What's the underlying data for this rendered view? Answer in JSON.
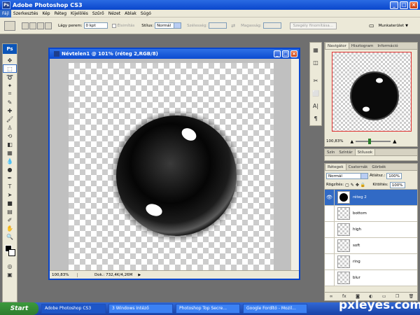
{
  "app": {
    "title": "Adobe Photoshop CS3",
    "ps_glyph": "Ps"
  },
  "menu": [
    "Fájl",
    "Szerkesztés",
    "Kép",
    "Réteg",
    "Kijelölés",
    "Szűrő",
    "Nézet",
    "Ablak",
    "Súgó"
  ],
  "options": {
    "feather_label": "Lágy perem:",
    "feather_value": "0 kpt",
    "antialias_label": "Élsimítás",
    "style_label": "Stílus:",
    "style_value": "Normál",
    "width_label": "Szélesség:",
    "height_label": "Magasság:",
    "refine_button": "Szegély finomítása...",
    "workspace_label": "Munkaterület"
  },
  "document": {
    "title": "Névtelen1 @ 101% (réteg 2,RGB/8)",
    "zoom": "100,83%",
    "doc_size": "Dok.: 732,4K/4,26M"
  },
  "navigator": {
    "tabs": [
      "Navigátor",
      "Hisztogram",
      "Információ"
    ],
    "zoom": "100,83%"
  },
  "color_panel": {
    "tabs": [
      "Szín",
      "Színtár",
      "Stílusok"
    ]
  },
  "layers_panel": {
    "tabs": [
      "Rétegek",
      "Csatornák",
      "Görbék"
    ],
    "blend_mode": "Normál",
    "opacity_label": "Átlátsz.:",
    "opacity_value": "100%",
    "lock_label": "Rögzítés:",
    "fill_label": "Kitöltés:",
    "fill_value": "100%",
    "layers": [
      {
        "name": "réteg 2",
        "selected": true,
        "visible": true
      },
      {
        "name": "bottom",
        "selected": false,
        "visible": false
      },
      {
        "name": "high",
        "selected": false,
        "visible": false
      },
      {
        "name": "soft",
        "selected": false,
        "visible": false
      },
      {
        "name": "ring",
        "selected": false,
        "visible": false
      },
      {
        "name": "blur",
        "selected": false,
        "visible": false
      }
    ]
  },
  "taskbar": {
    "start": "Start",
    "tasks": [
      "Adobe Photoshop CS3",
      "3 Windows Intéző",
      "Photoshop Top Secre...",
      "Google Fordító - Mozil..."
    ],
    "watermark": "pxleyes.com"
  },
  "colors": {
    "accent": "#316ac5",
    "title_blue": "#0a46cc",
    "start_green": "#3c9a3c"
  }
}
